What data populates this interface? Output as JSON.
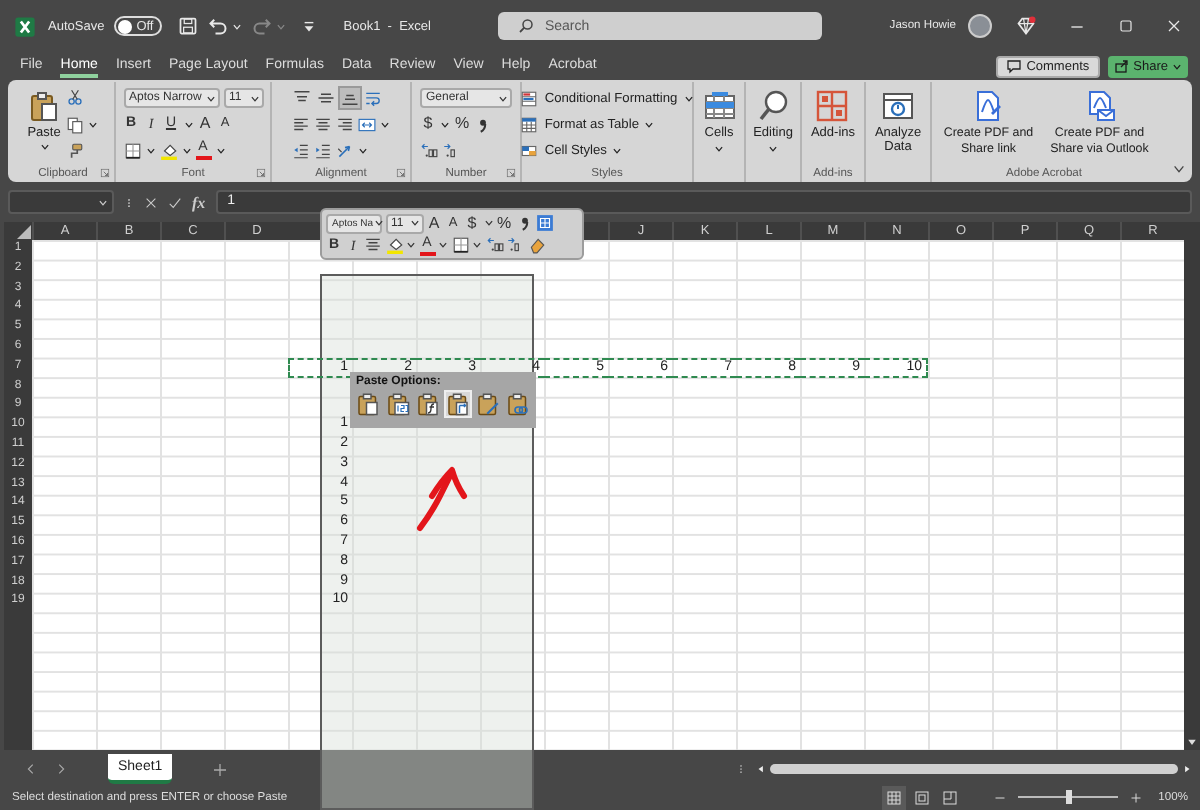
{
  "title_bar": {
    "autosave_label": "AutoSave",
    "autosave_toggle": {
      "label": "Off",
      "on": false
    },
    "document_title": "Book1  -  Excel",
    "search": {
      "placeholder": "Search"
    },
    "user_name": "Jason Howie"
  },
  "ribbon_tabs": [
    {
      "label": "File",
      "selected": false
    },
    {
      "label": "Home",
      "selected": true
    },
    {
      "label": "Insert",
      "selected": false
    },
    {
      "label": "Page Layout",
      "selected": false
    },
    {
      "label": "Formulas",
      "selected": false
    },
    {
      "label": "Data",
      "selected": false
    },
    {
      "label": "Review",
      "selected": false
    },
    {
      "label": "View",
      "selected": false
    },
    {
      "label": "Help",
      "selected": false
    },
    {
      "label": "Acrobat",
      "selected": false
    }
  ],
  "ribbon_actions": {
    "comments": "Comments",
    "share": "Share"
  },
  "ribbon_groups": [
    {
      "kind": "clipboard",
      "label": "Clipboard",
      "paste": "Paste"
    },
    {
      "kind": "font",
      "label": "Font",
      "font_name": "Aptos Narrow",
      "font_size": "11",
      "bold": "B",
      "italic": "I",
      "underline": "U",
      "grow": "A",
      "shrink": "A",
      "font_color": "A"
    },
    {
      "kind": "alignment",
      "label": "Alignment",
      "vertical_align": [
        {
          "kind": "top",
          "selected": false
        },
        {
          "kind": "middle",
          "selected": false
        },
        {
          "kind": "bottom",
          "selected": true
        }
      ]
    },
    {
      "kind": "number",
      "label": "Number",
      "format": "General",
      "currency": "$",
      "percent": "%"
    },
    {
      "kind": "styles",
      "label": "Styles",
      "items": [
        "Conditional Formatting",
        "Format as Table",
        "Cell Styles"
      ]
    },
    {
      "kind": "cells",
      "button": "Cells"
    },
    {
      "kind": "editing",
      "button": "Editing"
    },
    {
      "kind": "addins",
      "label": "Add-ins",
      "button": "Add-ins"
    },
    {
      "kind": "analyze",
      "button": "Analyze Data"
    },
    {
      "kind": "acrobat",
      "label": "Adobe Acrobat",
      "buttons": [
        "Create PDF and Share link",
        "Create PDF and Share via Outlook"
      ]
    }
  ],
  "formula_bar": {
    "function_label": "fx",
    "value": "1"
  },
  "mini_toolbar": {
    "font_name": "Aptos Na",
    "font_size": "11",
    "grow": "A",
    "shrink": "A",
    "currency": "$",
    "percent": "%",
    "bold": "B",
    "italic": "I",
    "font_color": "A"
  },
  "paste_options": {
    "title": "Paste Options:",
    "options": [
      {
        "kind": "paste",
        "selected": false
      },
      {
        "kind": "values",
        "selected": false
      },
      {
        "kind": "formulas",
        "selected": false
      },
      {
        "kind": "transpose",
        "selected": true
      },
      {
        "kind": "formatting",
        "selected": false
      },
      {
        "kind": "link",
        "selected": false
      }
    ]
  },
  "sheet": {
    "columns": [
      "A",
      "B",
      "C",
      "D",
      null,
      null,
      null,
      null,
      null,
      "J",
      "K",
      "L",
      "M",
      "N",
      "O",
      "P",
      "Q",
      "R"
    ],
    "rows": [
      {
        "number": "1"
      },
      {
        "number": "2"
      },
      {
        "number": "3"
      },
      {
        "number": "4"
      },
      {
        "number": "5"
      },
      {
        "number": "6"
      },
      {
        "number": "7",
        "copied": true,
        "cells": [
          null,
          null,
          null,
          null,
          "1",
          "2",
          "3",
          "4",
          "5",
          "6",
          "7",
          "8",
          "9",
          "10"
        ]
      },
      {
        "number": "8"
      },
      {
        "number": "9"
      },
      {
        "number": "10",
        "cells": [
          null,
          null,
          null,
          null,
          "1"
        ]
      },
      {
        "number": "11",
        "cells": [
          null,
          null,
          null,
          null,
          "2"
        ]
      },
      {
        "number": "12",
        "cells": [
          null,
          null,
          null,
          null,
          "3"
        ]
      },
      {
        "number": "13",
        "cells": [
          null,
          null,
          null,
          null,
          "4"
        ]
      },
      {
        "number": "14",
        "cells": [
          null,
          null,
          null,
          null,
          "5"
        ]
      },
      {
        "number": "15",
        "cells": [
          null,
          null,
          null,
          null,
          "6"
        ]
      },
      {
        "number": "16",
        "cells": [
          null,
          null,
          null,
          null,
          "7"
        ]
      },
      {
        "number": "17",
        "cells": [
          null,
          null,
          null,
          null,
          "8"
        ]
      },
      {
        "number": "18",
        "cells": [
          null,
          null,
          null,
          null,
          "9"
        ]
      },
      {
        "number": "19",
        "cells": [
          null,
          null,
          null,
          null,
          "10"
        ]
      }
    ]
  },
  "sheet_tabs": [
    {
      "label": "Sheet1",
      "selected": true
    }
  ],
  "status_bar": {
    "message": "Select destination and press ENTER or choose Paste",
    "views": [
      {
        "kind": "normal",
        "selected": true
      },
      {
        "kind": "page_layout",
        "selected": false
      },
      {
        "kind": "page_break",
        "selected": false
      }
    ],
    "zoom": {
      "level": 0.5
    },
    "zoom_label": "100%"
  }
}
